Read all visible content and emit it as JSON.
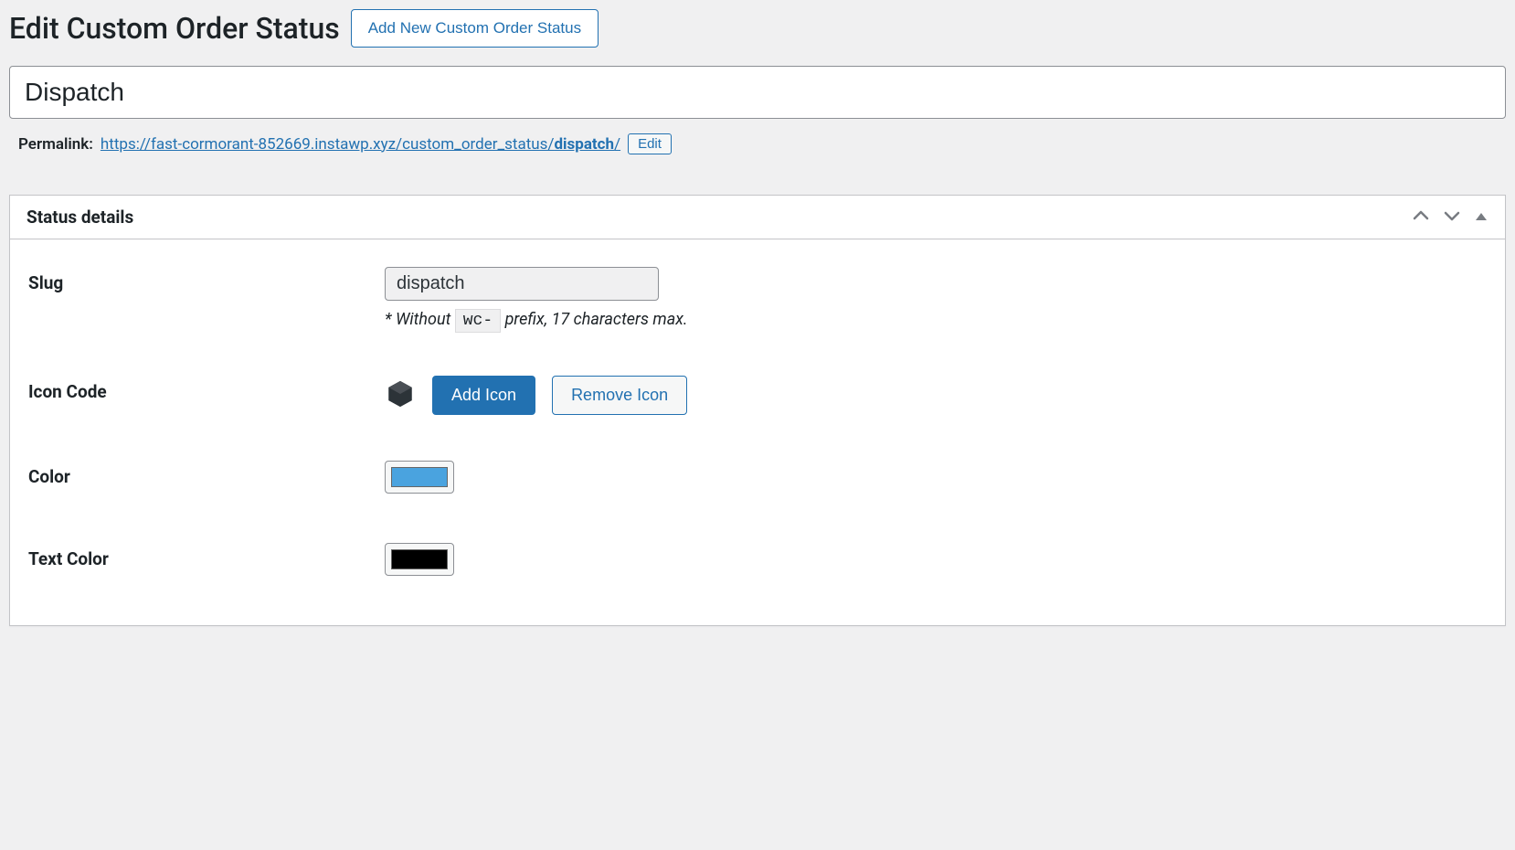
{
  "header": {
    "page_title": "Edit Custom Order Status",
    "add_new_button": "Add New Custom Order Status"
  },
  "title_input": {
    "value": "Dispatch"
  },
  "permalink": {
    "label": "Permalink:",
    "url_prefix": "https://fast-cormorant-852669.instawp.xyz/custom_order_status/",
    "slug": "dispatch",
    "trailing": "/",
    "edit_button": "Edit"
  },
  "panel": {
    "title": "Status details"
  },
  "fields": {
    "slug": {
      "label": "Slug",
      "value": "dispatch",
      "helper_prefix": "* Without ",
      "helper_code": "wc-",
      "helper_suffix": " prefix, 17 characters max."
    },
    "icon_code": {
      "label": "Icon Code",
      "add_button": "Add Icon",
      "remove_button": "Remove Icon"
    },
    "color": {
      "label": "Color",
      "value": "#4aa3df"
    },
    "text_color": {
      "label": "Text Color",
      "value": "#000000"
    }
  }
}
